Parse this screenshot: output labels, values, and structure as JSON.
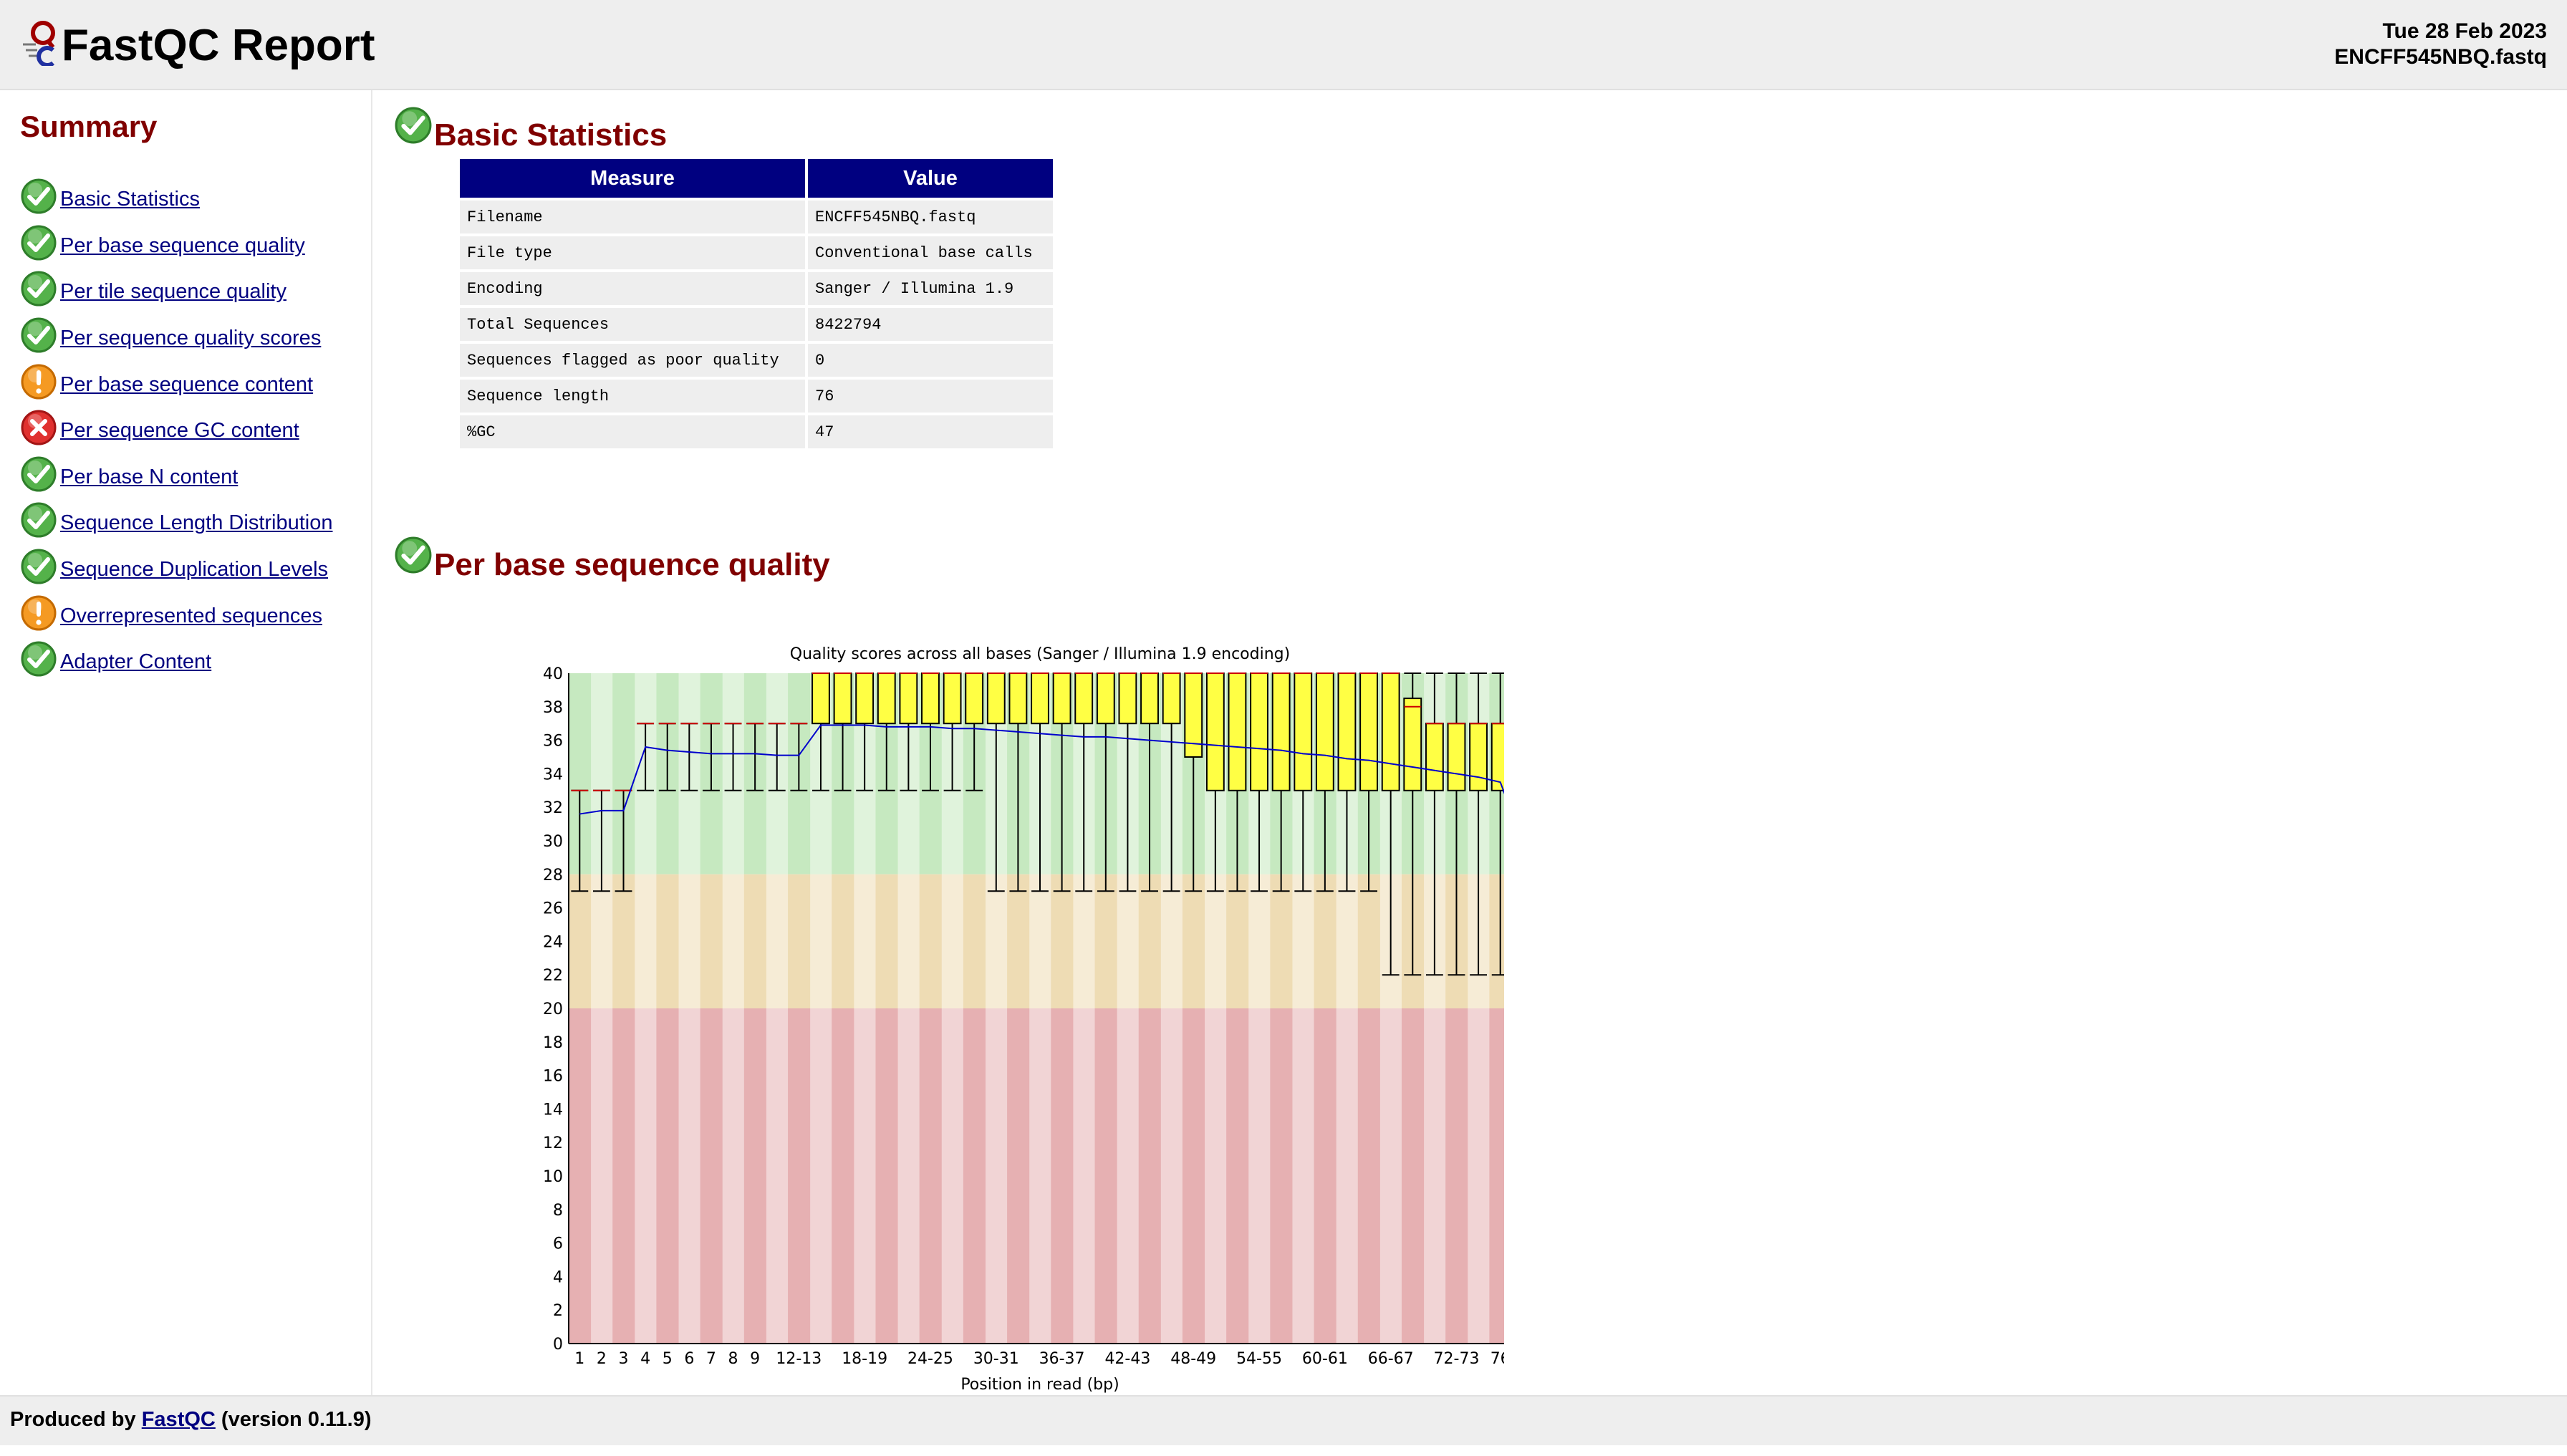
{
  "header": {
    "title": "FastQC Report",
    "date": "Tue 28 Feb 2023",
    "filename": "ENCFF545NBQ.fastq"
  },
  "summary": {
    "title": "Summary",
    "items": [
      {
        "label": "Basic Statistics",
        "status": "pass"
      },
      {
        "label": "Per base sequence quality",
        "status": "pass"
      },
      {
        "label": "Per tile sequence quality",
        "status": "pass"
      },
      {
        "label": "Per sequence quality scores",
        "status": "pass"
      },
      {
        "label": "Per base sequence content",
        "status": "warn"
      },
      {
        "label": "Per sequence GC content",
        "status": "fail"
      },
      {
        "label": "Per base N content",
        "status": "pass"
      },
      {
        "label": "Sequence Length Distribution",
        "status": "pass"
      },
      {
        "label": "Sequence Duplication Levels",
        "status": "pass"
      },
      {
        "label": "Overrepresented sequences",
        "status": "warn"
      },
      {
        "label": "Adapter Content",
        "status": "pass"
      }
    ]
  },
  "basic_stats": {
    "title": "Basic Statistics",
    "headers": [
      "Measure",
      "Value"
    ],
    "rows": [
      [
        "Filename",
        "ENCFF545NBQ.fastq"
      ],
      [
        "File type",
        "Conventional base calls"
      ],
      [
        "Encoding",
        "Sanger / Illumina 1.9"
      ],
      [
        "Total Sequences",
        "8422794"
      ],
      [
        "Sequences flagged as poor quality",
        "0"
      ],
      [
        "Sequence length",
        "76"
      ],
      [
        "%GC",
        "47"
      ]
    ]
  },
  "quality_section": {
    "title": "Per base sequence quality"
  },
  "chart_data": {
    "type": "box",
    "title": "Quality scores across all bases (Sanger / Illumina 1.9 encoding)",
    "xlabel": "Position in read (bp)",
    "ylabel": "",
    "ylim": [
      0,
      40
    ],
    "yticks": [
      0,
      2,
      4,
      6,
      8,
      10,
      12,
      14,
      16,
      18,
      20,
      22,
      24,
      26,
      28,
      30,
      32,
      34,
      36,
      38,
      40
    ],
    "zones": [
      {
        "from": 28,
        "to": 40,
        "color": "#c6e9c0"
      },
      {
        "from": 20,
        "to": 28,
        "color": "#eedcb4"
      },
      {
        "from": 0,
        "to": 20,
        "color": "#e6b0b2"
      }
    ],
    "colors": {
      "box": "#ffff44",
      "median": "#cc0000",
      "mean": "#0000cc"
    },
    "categories": [
      "1",
      "2",
      "3",
      "4",
      "5",
      "6",
      "7",
      "8",
      "9",
      "10-11",
      "12-13",
      "14-15",
      "16-17",
      "18-19",
      "20-21",
      "22-23",
      "24-25",
      "26-27",
      "28-29",
      "30-31",
      "32-33",
      "34-35",
      "36-37",
      "38-39",
      "40-41",
      "42-43",
      "44-45",
      "46-47",
      "48-49",
      "50-51",
      "52-53",
      "54-55",
      "56-57",
      "58-59",
      "60-61",
      "62-63",
      "64-65",
      "66-67",
      "68-69",
      "70-71",
      "72-73",
      "74-75",
      "76"
    ],
    "tick_labels": [
      "1",
      "2",
      "3",
      "4",
      "5",
      "6",
      "7",
      "8",
      "9",
      "12-13",
      "18-19",
      "24-25",
      "30-31",
      "36-37",
      "42-43",
      "48-49",
      "54-55",
      "60-61",
      "66-67",
      "72-73",
      "76"
    ],
    "boxes": [
      {
        "low": 27,
        "q1": 33,
        "median": 33,
        "q3": 33,
        "high": 33
      },
      {
        "low": 27,
        "q1": 33,
        "median": 33,
        "q3": 33,
        "high": 33
      },
      {
        "low": 27,
        "q1": 33,
        "median": 33,
        "q3": 33,
        "high": 33
      },
      {
        "low": 33,
        "q1": 37,
        "median": 37,
        "q3": 37,
        "high": 37
      },
      {
        "low": 33,
        "q1": 37,
        "median": 37,
        "q3": 37,
        "high": 37
      },
      {
        "low": 33,
        "q1": 37,
        "median": 37,
        "q3": 37,
        "high": 37
      },
      {
        "low": 33,
        "q1": 37,
        "median": 37,
        "q3": 37,
        "high": 37
      },
      {
        "low": 33,
        "q1": 37,
        "median": 37,
        "q3": 37,
        "high": 37
      },
      {
        "low": 33,
        "q1": 37,
        "median": 37,
        "q3": 37,
        "high": 37
      },
      {
        "low": 33,
        "q1": 37,
        "median": 37,
        "q3": 37,
        "high": 37
      },
      {
        "low": 33,
        "q1": 37,
        "median": 37,
        "q3": 37,
        "high": 37
      },
      {
        "low": 33,
        "q1": 37,
        "median": 40,
        "q3": 40,
        "high": 40
      },
      {
        "low": 33,
        "q1": 37,
        "median": 40,
        "q3": 40,
        "high": 40
      },
      {
        "low": 33,
        "q1": 37,
        "median": 40,
        "q3": 40,
        "high": 40
      },
      {
        "low": 33,
        "q1": 37,
        "median": 40,
        "q3": 40,
        "high": 40
      },
      {
        "low": 33,
        "q1": 37,
        "median": 40,
        "q3": 40,
        "high": 40
      },
      {
        "low": 33,
        "q1": 37,
        "median": 40,
        "q3": 40,
        "high": 40
      },
      {
        "low": 33,
        "q1": 37,
        "median": 40,
        "q3": 40,
        "high": 40
      },
      {
        "low": 33,
        "q1": 37,
        "median": 40,
        "q3": 40,
        "high": 40
      },
      {
        "low": 27,
        "q1": 37,
        "median": 40,
        "q3": 40,
        "high": 40
      },
      {
        "low": 27,
        "q1": 37,
        "median": 40,
        "q3": 40,
        "high": 40
      },
      {
        "low": 27,
        "q1": 37,
        "median": 40,
        "q3": 40,
        "high": 40
      },
      {
        "low": 27,
        "q1": 37,
        "median": 40,
        "q3": 40,
        "high": 40
      },
      {
        "low": 27,
        "q1": 37,
        "median": 40,
        "q3": 40,
        "high": 40
      },
      {
        "low": 27,
        "q1": 37,
        "median": 40,
        "q3": 40,
        "high": 40
      },
      {
        "low": 27,
        "q1": 37,
        "median": 40,
        "q3": 40,
        "high": 40
      },
      {
        "low": 27,
        "q1": 37,
        "median": 40,
        "q3": 40,
        "high": 40
      },
      {
        "low": 27,
        "q1": 37,
        "median": 40,
        "q3": 40,
        "high": 40
      },
      {
        "low": 27,
        "q1": 35,
        "median": 40,
        "q3": 40,
        "high": 40
      },
      {
        "low": 27,
        "q1": 33,
        "median": 40,
        "q3": 40,
        "high": 40
      },
      {
        "low": 27,
        "q1": 33,
        "median": 40,
        "q3": 40,
        "high": 40
      },
      {
        "low": 27,
        "q1": 33,
        "median": 40,
        "q3": 40,
        "high": 40
      },
      {
        "low": 27,
        "q1": 33,
        "median": 40,
        "q3": 40,
        "high": 40
      },
      {
        "low": 27,
        "q1": 33,
        "median": 40,
        "q3": 40,
        "high": 40
      },
      {
        "low": 27,
        "q1": 33,
        "median": 40,
        "q3": 40,
        "high": 40
      },
      {
        "low": 27,
        "q1": 33,
        "median": 40,
        "q3": 40,
        "high": 40
      },
      {
        "low": 27,
        "q1": 33,
        "median": 40,
        "q3": 40,
        "high": 40
      },
      {
        "low": 22,
        "q1": 33,
        "median": 40,
        "q3": 40,
        "high": 40
      },
      {
        "low": 22,
        "q1": 33,
        "median": 38,
        "q3": 38.5,
        "high": 40
      },
      {
        "low": 22,
        "q1": 33,
        "median": 37,
        "q3": 37,
        "high": 40
      },
      {
        "low": 22,
        "q1": 33,
        "median": 37,
        "q3": 37,
        "high": 40
      },
      {
        "low": 22,
        "q1": 33,
        "median": 37,
        "q3": 37,
        "high": 40
      },
      {
        "low": 22,
        "q1": 33,
        "median": 37,
        "q3": 37,
        "high": 40
      }
    ],
    "mean": [
      31.6,
      31.8,
      31.8,
      35.6,
      35.4,
      35.3,
      35.2,
      35.2,
      35.2,
      35.1,
      35.1,
      36.9,
      36.9,
      36.9,
      36.8,
      36.8,
      36.8,
      36.7,
      36.7,
      36.6,
      36.5,
      36.4,
      36.3,
      36.2,
      36.2,
      36.1,
      36.0,
      35.9,
      35.8,
      35.7,
      35.6,
      35.5,
      35.4,
      35.2,
      35.1,
      34.9,
      34.8,
      34.6,
      34.4,
      34.2,
      34.0,
      33.8,
      33.5,
      32.1
    ]
  },
  "footer": {
    "prefix": "Produced by",
    "link": "FastQC",
    "suffix": "(version 0.11.9)"
  }
}
